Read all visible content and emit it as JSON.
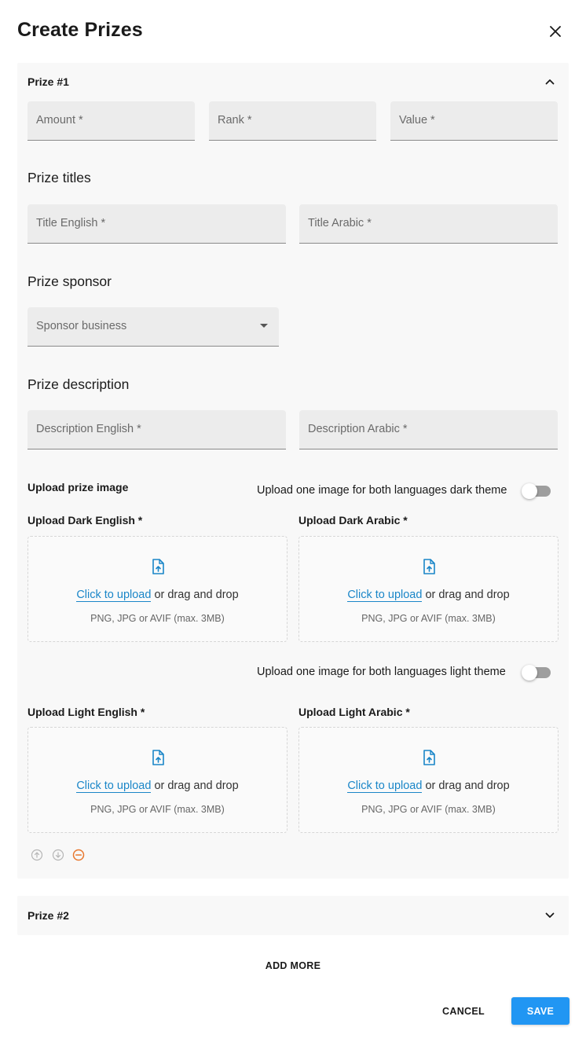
{
  "dialog": {
    "title": "Create Prizes",
    "close_icon": "close-icon"
  },
  "prize1": {
    "header": "Prize #1",
    "expanded": true,
    "fields": {
      "amount": "Amount *",
      "rank": "Rank *",
      "value": "Value *"
    },
    "titles_heading": "Prize titles",
    "title_english": "Title English *",
    "title_arabic": "Title Arabic *",
    "sponsor_heading": "Prize sponsor",
    "sponsor_select": "Sponsor business",
    "description_heading": "Prize description",
    "description_english": "Description English *",
    "description_arabic": "Description Arabic *",
    "upload_heading": "Upload prize image",
    "dark_toggle_label": "Upload one image for both languages dark theme",
    "dark_toggle_on": false,
    "light_toggle_label": "Upload one image for both languages light theme",
    "light_toggle_on": false,
    "uploads": {
      "dark_english": "Upload Dark English *",
      "dark_arabic": "Upload Dark Arabic *",
      "light_english": "Upload Light English *",
      "light_arabic": "Upload Light Arabic *"
    },
    "dropzone": {
      "link": "Click to upload",
      "rest": " or drag and drop",
      "hint": "PNG, JPG or AVIF (max. 3MB)"
    },
    "controls": [
      "move-up-icon",
      "move-down-icon",
      "remove-icon"
    ]
  },
  "prize2": {
    "header": "Prize #2",
    "expanded": false
  },
  "actions": {
    "add_more": "ADD MORE",
    "cancel": "CANCEL",
    "save": "SAVE"
  },
  "colors": {
    "accent": "#2196f3",
    "link": "#1a86c8",
    "remove": "#e8772e",
    "field_bg": "#ececec",
    "panel_bg": "#f8f8f8"
  }
}
